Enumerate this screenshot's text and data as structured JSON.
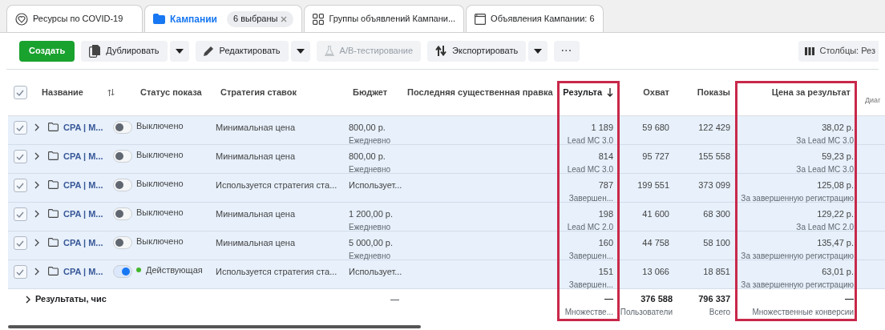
{
  "tabs": [
    {
      "label": "Ресурсы по COVID-19",
      "selected": false
    },
    {
      "label": "Кампании",
      "selected": true,
      "badge": "6 выбраны"
    },
    {
      "label": "Группы объявлений Кампани...",
      "selected": false
    },
    {
      "label": "Объявления Кампании: 6",
      "selected": false
    }
  ],
  "toolbar": {
    "buttons": [
      {
        "label": "Создать",
        "kind": "primary",
        "disabled": false
      },
      {
        "label": "Дублировать",
        "kind": "split",
        "disabled": false
      },
      {
        "label": "Редактировать",
        "kind": "split",
        "disabled": false
      },
      {
        "label": "A/B-тестирование",
        "kind": "plain",
        "disabled": true
      },
      {
        "label": "Экспортировать",
        "kind": "split",
        "disabled": false
      },
      {
        "label": "···",
        "kind": "more",
        "disabled": false
      }
    ],
    "columns_button": "Столбцы: Рез"
  },
  "table": {
    "select_all": true,
    "columns": [
      {
        "label": "Название",
        "sortable": true,
        "highlighted": false
      },
      {
        "label": "Статус показа",
        "highlighted": false
      },
      {
        "label": "Стратегия ставок",
        "highlighted": false
      },
      {
        "label": "Бюджет",
        "highlighted": false
      },
      {
        "label": "Последняя существенная правка",
        "highlighted": false
      },
      {
        "label": "Результа",
        "sorted": true,
        "highlighted": true
      },
      {
        "label": "Охват",
        "highlighted": false
      },
      {
        "label": "Показы",
        "highlighted": false
      },
      {
        "label": "Цена за результат",
        "highlighted": true
      },
      {
        "label": "Диаг",
        "highlighted": false
      }
    ],
    "rows": [
      {
        "selected": true,
        "name": "CPA | M...",
        "on": false,
        "status": "Выключено",
        "strategy": "Минимальная цена",
        "budget": "800,00 р.",
        "budget_note": "Ежедневно",
        "results": "1 189",
        "results_note": "Lead MC 3.0",
        "reach": "59 680",
        "impressions": "122 429",
        "cost": "38,02 р.",
        "cost_note": "За Lead MC 3.0"
      },
      {
        "selected": true,
        "name": "CPA | M...",
        "on": false,
        "status": "Выключено",
        "strategy": "Минимальная цена",
        "budget": "800,00 р.",
        "budget_note": "Ежедневно",
        "results": "814",
        "results_note": "Lead MC 3.0",
        "reach": "95 727",
        "impressions": "155 558",
        "cost": "59,23 р.",
        "cost_note": "За Lead MC 3.0"
      },
      {
        "selected": true,
        "name": "CPA | M...",
        "on": false,
        "status": "Выключено",
        "strategy": "Используется стратегия ста...",
        "budget": "Использует...",
        "results": "787",
        "results_note": "Завершен...",
        "reach": "199 551",
        "impressions": "373 099",
        "cost": "125,08 р.",
        "cost_note": "За завершенную регистрацию"
      },
      {
        "selected": true,
        "name": "CPA | M...",
        "on": false,
        "status": "Выключено",
        "strategy": "Минимальная цена",
        "budget": "1 200,00 р.",
        "budget_note": "Ежедневно",
        "results": "198",
        "results_note": "Lead MC 2.0",
        "reach": "41 600",
        "impressions": "68 300",
        "cost": "129,22 р.",
        "cost_note": "За Lead MC 2.0"
      },
      {
        "selected": true,
        "name": "CPA | M...",
        "on": false,
        "status": "Выключено",
        "strategy": "Минимальная цена",
        "budget": "5 000,00 р.",
        "budget_note": "Ежедневно",
        "results": "160",
        "results_note": "Завершен...",
        "reach": "44 758",
        "impressions": "58 100",
        "cost": "135,47 р.",
        "cost_note": "За завершенную регистрацию"
      },
      {
        "selected": true,
        "name": "CPA | M...",
        "on": true,
        "status": "Действующая",
        "strategy": "Используется стратегия ста...",
        "budget": "Использует...",
        "results": "151",
        "results_note": "Завершен...",
        "reach": "13 066",
        "impressions": "18 851",
        "cost": "63,01 р.",
        "cost_note": "За завершенную регистрацию"
      }
    ],
    "totals": {
      "label": "Результаты, чис",
      "budget": "—",
      "results": "—",
      "results_note": "Множестве...",
      "reach": "376 588",
      "reach_note": "Пользователи",
      "impressions": "796 337",
      "impressions_note": "Всего",
      "cost": "—",
      "cost_note": "Множественные конверсии"
    }
  }
}
